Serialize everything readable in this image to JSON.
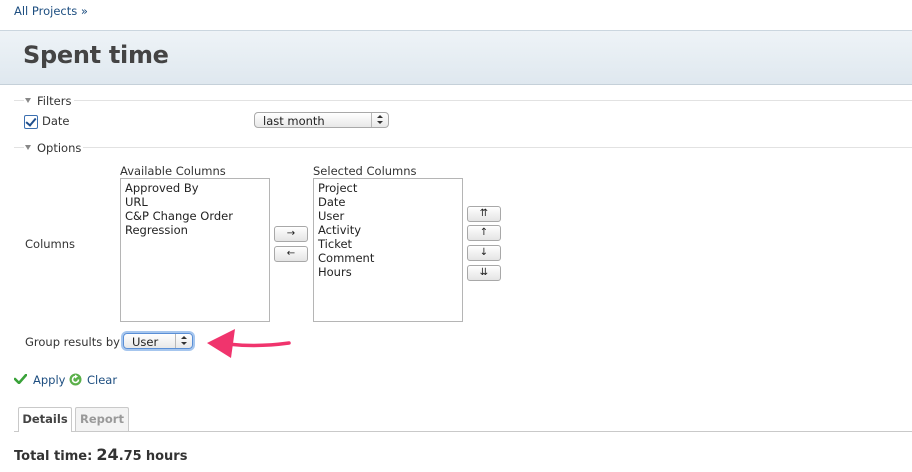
{
  "breadcrumb": {
    "project_link": "All Projects »"
  },
  "page": {
    "title": "Spent time"
  },
  "filters": {
    "legend": "Filters",
    "date_label": "Date",
    "date_checked": true,
    "date_value": "last month"
  },
  "options": {
    "legend": "Options",
    "columns_label": "Columns",
    "available_label": "Available Columns",
    "available_columns": [
      "Approved By",
      "URL",
      "C&P Change Order",
      "Regression"
    ],
    "selected_label": "Selected Columns",
    "selected_columns": [
      "Project",
      "Date",
      "User",
      "Activity",
      "Ticket",
      "Comment",
      "Hours"
    ],
    "move_right": "→",
    "move_left": "←",
    "move_top": "⇈",
    "move_up": "↑",
    "move_down": "↓",
    "move_bottom": "⇊",
    "group_label": "Group results by",
    "group_value": "User"
  },
  "actions": {
    "apply": "Apply",
    "clear": "Clear"
  },
  "tabs": [
    {
      "label": "Details",
      "active": true
    },
    {
      "label": "Report",
      "active": false
    }
  ],
  "total": {
    "label": "Total time:",
    "value_int": "24",
    "value_dec": ".75",
    "unit": "hours"
  },
  "colors": {
    "link": "#1d4e80",
    "arrow": "#f0346d",
    "apply_green": "#3aa23a"
  }
}
